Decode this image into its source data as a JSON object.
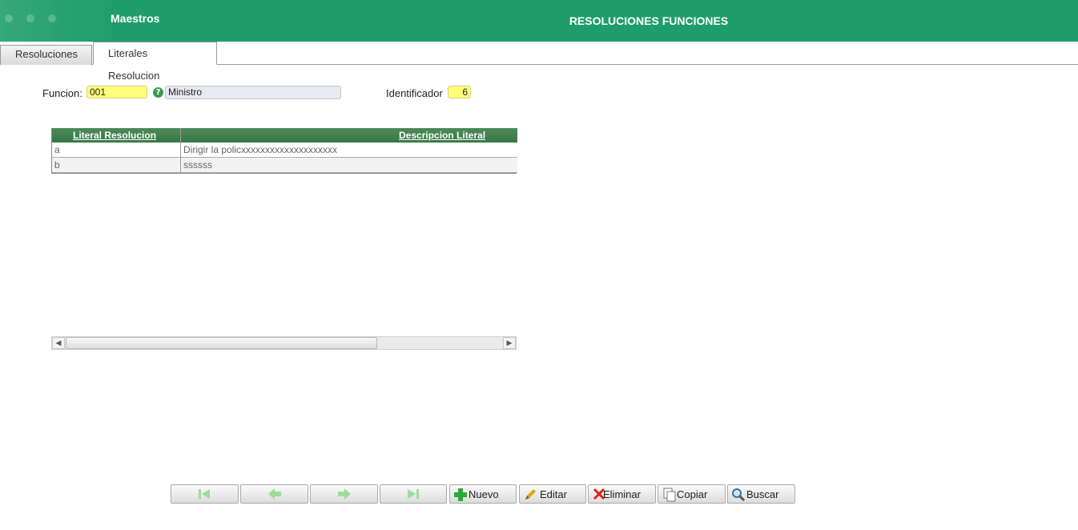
{
  "header": {
    "section": "Maestros",
    "title": "RESOLUCIONES FUNCIONES"
  },
  "tabs": [
    {
      "label": "Resoluciones",
      "active": false
    },
    {
      "label": "Literales Resolucion",
      "active": true
    }
  ],
  "form": {
    "funcion_label": "Funcion:",
    "funcion_value": "001",
    "funcion_desc": "Ministro",
    "identificador_label": "Identificador",
    "identificador_value": "6"
  },
  "grid": {
    "columns": [
      "Literal Resolucion",
      "Descripcion Literal"
    ],
    "rows": [
      [
        "a",
        "Dirigir la policxxxxxxxxxxxxxxxxxxxx"
      ],
      [
        "b",
        "ssssss"
      ]
    ]
  },
  "toolbar": {
    "nuevo": "Nuevo",
    "editar": "Editar",
    "eliminar": "Eliminar",
    "copiar": "Copiar",
    "buscar": "Buscar"
  },
  "colors": {
    "header_bg": "#1f9e6b",
    "grid_header_bg": "#357846",
    "input_yellow": "#ffff7a"
  }
}
